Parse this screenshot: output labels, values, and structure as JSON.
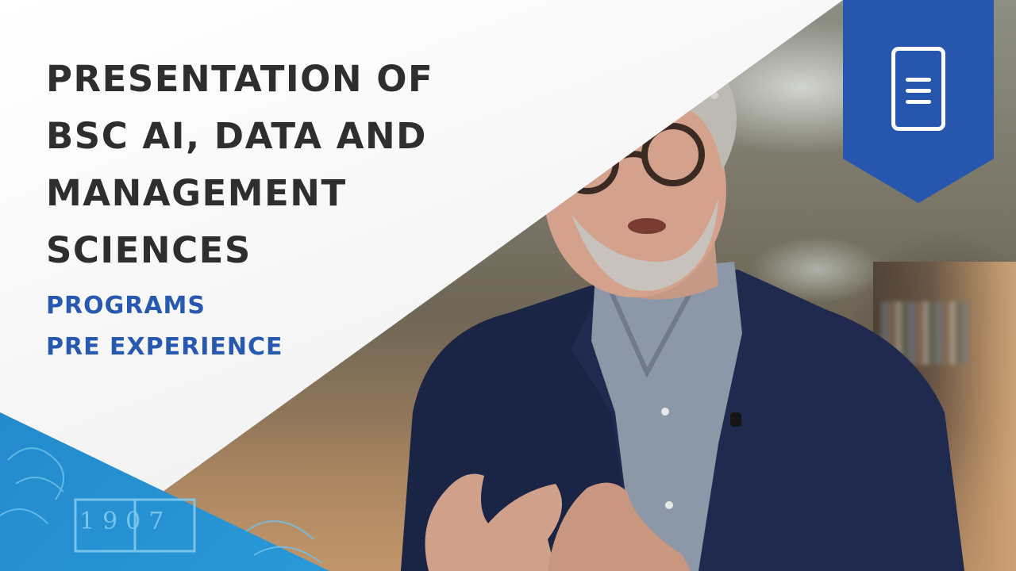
{
  "thumbnail": {
    "title_lines": [
      "PRESENTATION OF",
      "BSC AI, DATA AND",
      "MANAGEMENT",
      "SCIENCES"
    ],
    "subtitle_lines": [
      "PROGRAMS",
      "PRE EXPERIENCE"
    ],
    "emblem_year": "1907",
    "badge_icon": "document-icon",
    "colors": {
      "title": "#2e2e2e",
      "subtitle": "#2759b0",
      "badge": "#2656ad",
      "corner": "#2a9ad8",
      "panel": "#ffffff"
    }
  }
}
